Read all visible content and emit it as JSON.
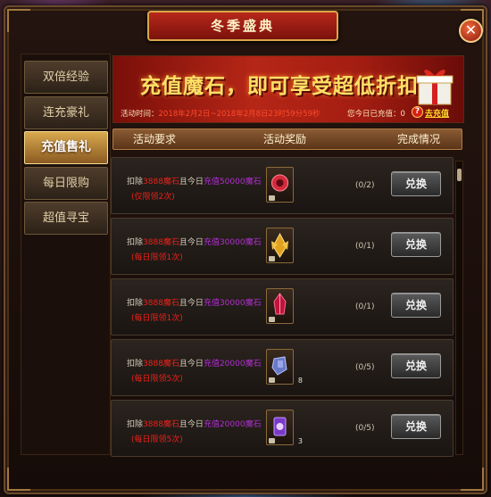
{
  "window": {
    "title": "冬季盛典",
    "close_label": "✕"
  },
  "sidebar": {
    "items": [
      {
        "label": "双倍经验",
        "active": false
      },
      {
        "label": "连充豪礼",
        "active": false
      },
      {
        "label": "充值售礼",
        "active": true
      },
      {
        "label": "每日限购",
        "active": false
      },
      {
        "label": "超值寻宝",
        "active": false
      }
    ]
  },
  "banner": {
    "headline_main": "充值魔石",
    "headline_rest": "，即可享受超低折扣",
    "time_label": "活动时间：",
    "time_value": "2018年2月2日~2018年2月8日23时59分59秒",
    "recharge_label": "您今日已充值：0",
    "help_label": "?",
    "go_recharge": "去充值"
  },
  "table": {
    "headers": {
      "requirement": "活动要求",
      "reward": "活动奖励",
      "status": "完成情况"
    }
  },
  "rows": [
    {
      "req_prefix": "扣除",
      "req_amount": "3888魔石",
      "req_mid": "且今日",
      "req_recharge": "充值50000魔石",
      "req_limit": "(仅限领2次)",
      "item_icon": "red-gem-icon",
      "item_color": "#d42a3a",
      "item_qty": "",
      "progress": "(0/2)",
      "button": "兑换"
    },
    {
      "req_prefix": "扣除",
      "req_amount": "3888魔石",
      "req_mid": "且今日",
      "req_recharge": "充值30000魔石",
      "req_limit": "(每日限领1次)",
      "item_icon": "gold-wing-icon",
      "item_color": "#e3a21e",
      "item_qty": "",
      "progress": "(0/1)",
      "button": "兑换"
    },
    {
      "req_prefix": "扣除",
      "req_amount": "3888魔石",
      "req_mid": "且今日",
      "req_recharge": "充值30000魔石",
      "req_limit": "(每日限领1次)",
      "item_icon": "crimson-crystal-icon",
      "item_color": "#c0143c",
      "item_qty": "",
      "progress": "(0/1)",
      "button": "兑换"
    },
    {
      "req_prefix": "扣除",
      "req_amount": "3888魔石",
      "req_mid": "且今日",
      "req_recharge": "充值20000魔石",
      "req_limit": "(每日限领5次)",
      "item_icon": "blue-stone-icon",
      "item_color": "#6a78c8",
      "item_qty": "8",
      "progress": "(0/5)",
      "button": "兑换"
    },
    {
      "req_prefix": "扣除",
      "req_amount": "3888魔石",
      "req_mid": "且今日",
      "req_recharge": "充值20000魔石",
      "req_limit": "(每日限领5次)",
      "item_icon": "purple-scroll-icon",
      "item_color": "#7a3ac8",
      "item_qty": "3",
      "progress": "(0/5)",
      "button": "兑换"
    }
  ]
}
